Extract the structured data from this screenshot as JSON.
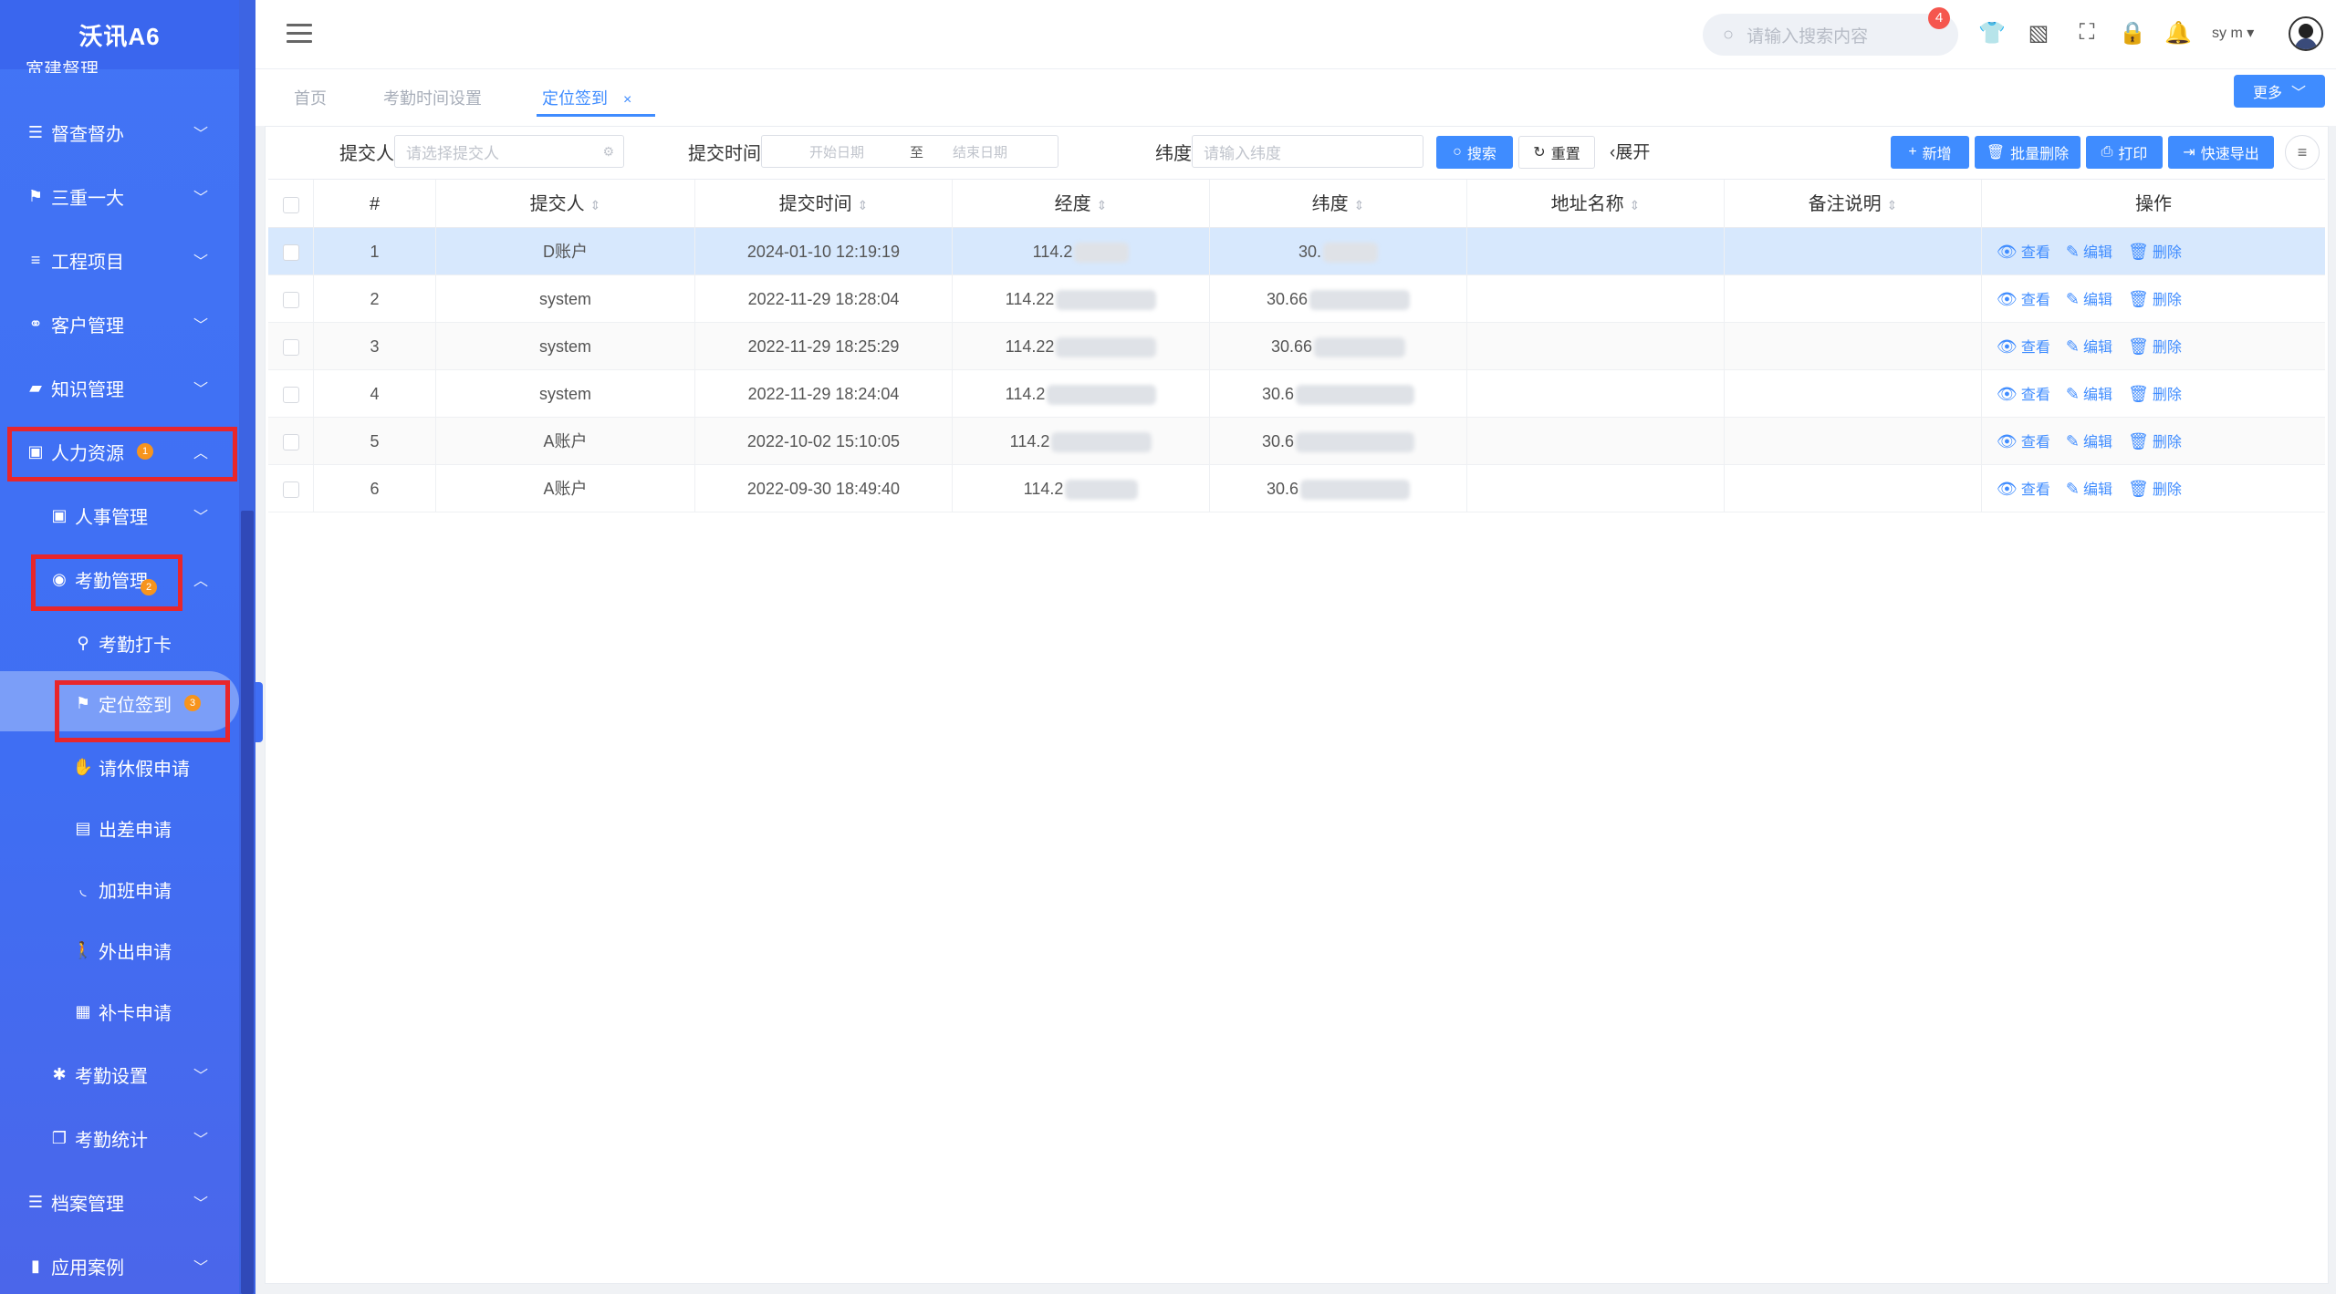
{
  "app": {
    "title": "沃讯A6",
    "clipped_item": "宽建督理"
  },
  "sidebar": {
    "items": [
      {
        "label": "督查督办",
        "icon": "list-icon"
      },
      {
        "label": "三重一大",
        "icon": "flag-icon"
      },
      {
        "label": "工程项目",
        "icon": "bars-icon"
      },
      {
        "label": "客户管理",
        "icon": "handshake-icon"
      },
      {
        "label": "知识管理",
        "icon": "book-icon"
      },
      {
        "label": "人力资源",
        "icon": "id-card-icon",
        "badge": "1"
      },
      {
        "label": "人事管理",
        "icon": "person-card-icon"
      },
      {
        "label": "考勤管理",
        "icon": "user-circle-icon",
        "badge": "2"
      },
      {
        "label": "考勤打卡",
        "icon": "map-pin-icon"
      },
      {
        "label": "定位签到",
        "icon": "flag-icon",
        "badge": "3"
      },
      {
        "label": "请休假申请",
        "icon": "hand-icon"
      },
      {
        "label": "出差申请",
        "icon": "bus-icon"
      },
      {
        "label": "加班申请",
        "icon": "rss-icon"
      },
      {
        "label": "外出申请",
        "icon": "walk-icon"
      },
      {
        "label": "补卡申请",
        "icon": "calendar-plus-icon"
      },
      {
        "label": "考勤设置",
        "icon": "gear-icon"
      },
      {
        "label": "考勤统计",
        "icon": "copy-icon"
      },
      {
        "label": "档案管理",
        "icon": "list-icon"
      },
      {
        "label": "应用案例",
        "icon": "file-icon"
      }
    ]
  },
  "topbar": {
    "search_placeholder": "请输入搜索内容",
    "notification_count": "4",
    "username": "sy  m"
  },
  "tabs": [
    {
      "label": "首页"
    },
    {
      "label": "考勤时间设置"
    },
    {
      "label": "定位签到",
      "close": "×",
      "active": true
    }
  ],
  "more_button": "更多",
  "filters": {
    "submitter_label": "提交人",
    "submitter_placeholder": "请选择提交人",
    "time_label": "提交时间",
    "start_placeholder": "开始日期",
    "range_sep": "至",
    "end_placeholder": "结束日期",
    "lat_label": "纬度",
    "lat_placeholder": "请输入纬度",
    "search_btn": "搜索",
    "reset_btn": "重置",
    "expand": "展开"
  },
  "toolbar": {
    "add": "新增",
    "batch_delete": "批量删除",
    "print": "打印",
    "export": "快速导出"
  },
  "table": {
    "headers": [
      "#",
      "提交人",
      "提交时间",
      "经度",
      "纬度",
      "地址名称",
      "备注说明",
      "操作"
    ],
    "actions": {
      "view": "查看",
      "edit": "编辑",
      "delete": "删除"
    },
    "rows": [
      {
        "no": "1",
        "submitter": "D账户",
        "time": "2024-01-10 12:19:19",
        "lng": "114.2",
        "lat": "30."
      },
      {
        "no": "2",
        "submitter": "system",
        "time": "2022-11-29 18:28:04",
        "lng": "114.22",
        "lat": "30.66"
      },
      {
        "no": "3",
        "submitter": "system",
        "time": "2022-11-29 18:25:29",
        "lng": "114.22",
        "lat": "30.66"
      },
      {
        "no": "4",
        "submitter": "system",
        "time": "2022-11-29 18:24:04",
        "lng": "114.2",
        "lat": "30.6"
      },
      {
        "no": "5",
        "submitter": "A账户",
        "time": "2022-10-02 15:10:05",
        "lng": "114.2",
        "lat": "30.6"
      },
      {
        "no": "6",
        "submitter": "A账户",
        "time": "2022-09-30 18:49:40",
        "lng": "114.2",
        "lat": "30.6"
      }
    ]
  },
  "colors": {
    "sidebar": "#3f6ef4",
    "accent": "#3f8cff",
    "highlight_box": "#e8262b",
    "badge": "#f7941d"
  }
}
